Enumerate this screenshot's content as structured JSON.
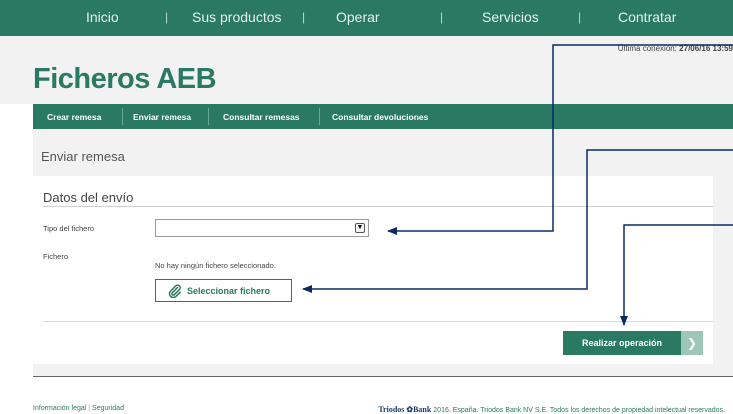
{
  "top_nav": {
    "items": [
      "Inicio",
      "Sus productos",
      "Operar",
      "Servicios",
      "Contratar"
    ],
    "separator": "|"
  },
  "header": {
    "last_connection_label": "Última conexión:",
    "last_connection_value": "27/06/16 13:59",
    "logo": "Ficheros AEB"
  },
  "sub_nav": {
    "items": [
      "Crear remesa",
      "Enviar remesa",
      "Consultar remesas",
      "Consultar devoluciones"
    ]
  },
  "page": {
    "title": "Enviar remesa"
  },
  "form": {
    "section_title": "Datos del envío",
    "file_type_label": "Tipo del fichero",
    "file_type_value": "",
    "file_label": "Fichero",
    "no_file_text": "No hay ningún fichero seleccionado.",
    "select_file_button": "Seleccionar fichero",
    "submit_button": "Realizar operación"
  },
  "footer": {
    "legal_link": "Información legal",
    "security_link": "Seguridad",
    "separator": "|",
    "brand": "Triodos",
    "brand_bank": "Bank",
    "copyright": "2016. España. Triodos Bank NV S.E. Todos los derechos de propiedad intelectual reservados."
  },
  "colors": {
    "brand_green": "#2a7962",
    "light_green": "#9dc6b9",
    "annotation_arrow": "#0a2a66",
    "panel_bg": "#f2f2f2"
  },
  "icons": {
    "select_arrow": "chevron-down-icon",
    "attach": "paperclip-icon",
    "submit_arrow": "chevron-right-icon"
  }
}
